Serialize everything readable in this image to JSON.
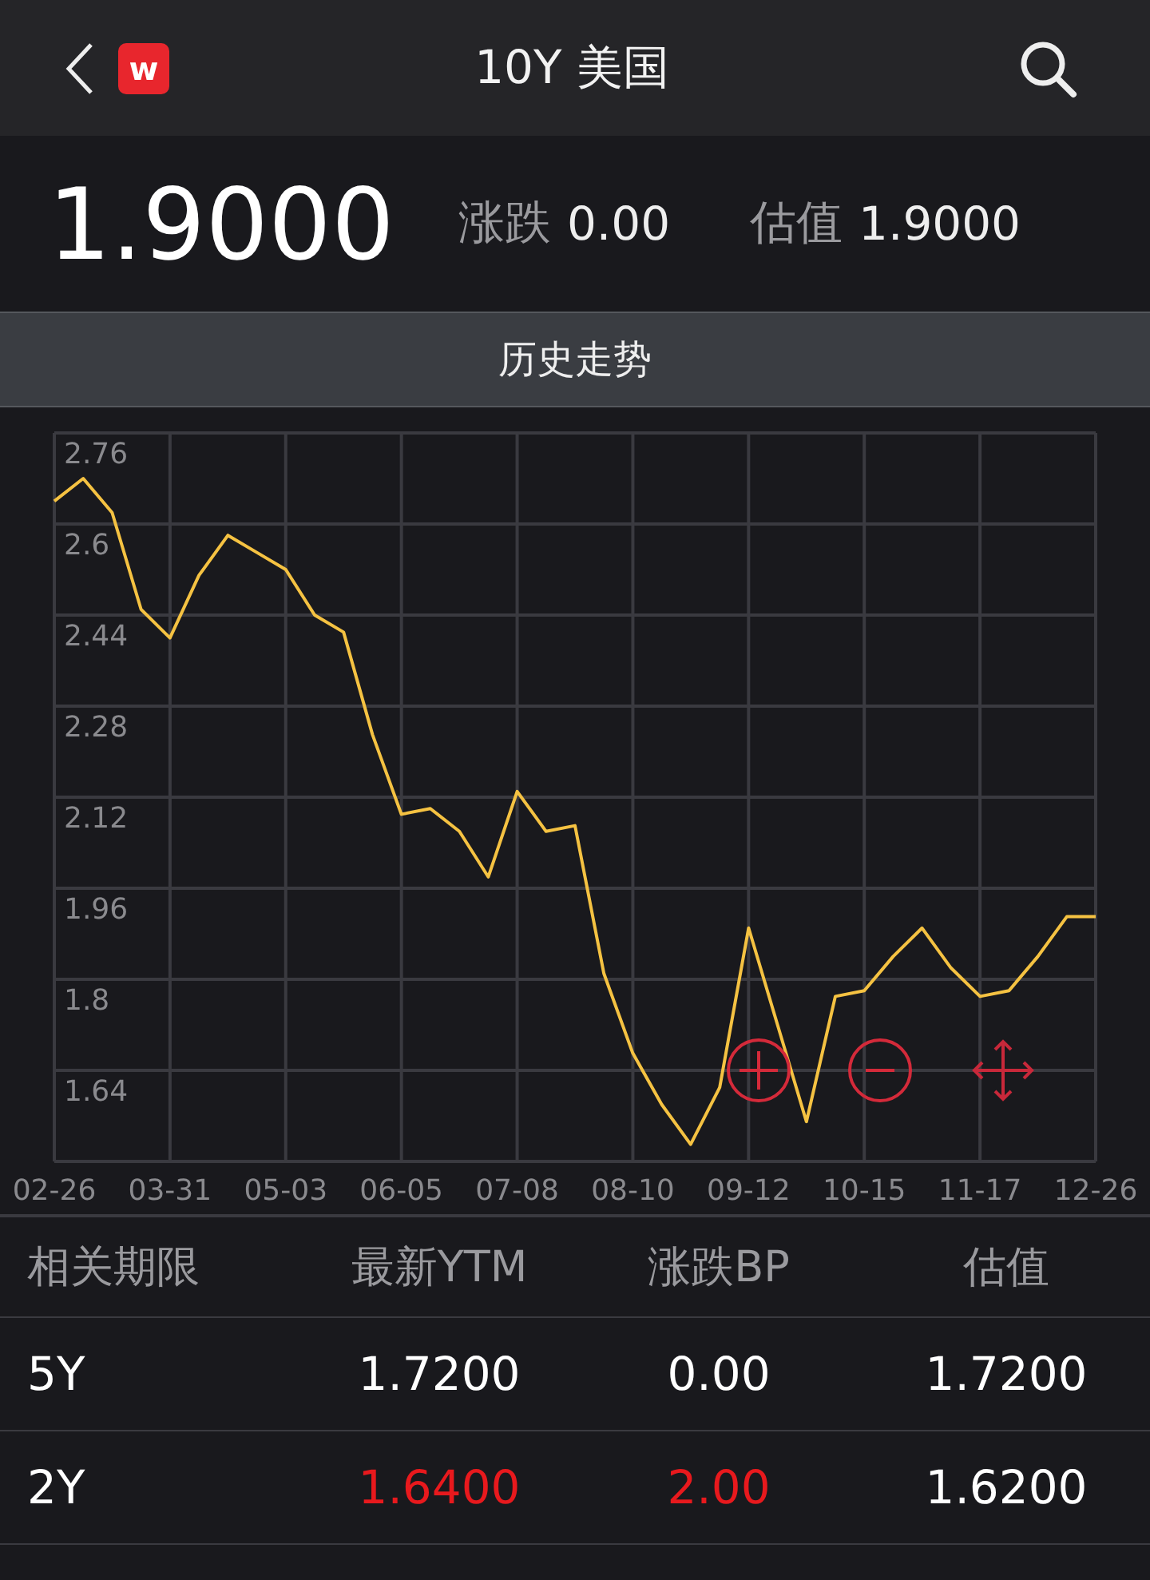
{
  "header": {
    "title": "10Y 美国",
    "logo": "w"
  },
  "summary": {
    "price": "1.9000",
    "change_label": "涨跌",
    "change": "0.00",
    "valuation_label": "估值",
    "valuation": "1.9000"
  },
  "tab": {
    "label": "历史走势"
  },
  "chart": {
    "chart_data": {
      "type": "line",
      "categories": [
        "02-26",
        null,
        null,
        null,
        "03-31",
        null,
        null,
        null,
        "05-03",
        null,
        null,
        null,
        "06-05",
        null,
        null,
        null,
        "07-08",
        null,
        null,
        null,
        "08-10",
        null,
        null,
        null,
        "09-12",
        null,
        null,
        null,
        "10-15",
        null,
        null,
        null,
        "11-17",
        null,
        null,
        null,
        "12-26"
      ],
      "series": [
        {
          "color": "#f5c242",
          "values": [
            2.64,
            2.68,
            2.62,
            2.45,
            2.4,
            2.51,
            2.58,
            2.55,
            2.52,
            2.44,
            2.41,
            2.23,
            2.09,
            2.1,
            2.06,
            1.98,
            2.13,
            2.06,
            2.07,
            1.81,
            1.67,
            1.58,
            1.51,
            1.61,
            1.89,
            1.72,
            1.55,
            1.77,
            1.78,
            1.84,
            1.89,
            1.82,
            1.77,
            1.78,
            1.84,
            1.91,
            1.91
          ]
        }
      ],
      "grid": true,
      "ylim": [
        1.48,
        2.76
      ],
      "yticks": [
        1.64,
        1.8,
        1.96,
        2.12,
        2.28,
        2.44,
        2.6,
        2.76
      ]
    }
  },
  "table": {
    "columns": [
      "相关期限",
      "最新YTM",
      "涨跌BP",
      "估值"
    ],
    "rows": [
      {
        "term": "5Y",
        "ytm": "1.7200",
        "change": "0.00",
        "valuation": "1.7200",
        "rising": false
      },
      {
        "term": "2Y",
        "ytm": "1.6400",
        "change": "2.00",
        "valuation": "1.6200",
        "rising": true
      }
    ]
  }
}
